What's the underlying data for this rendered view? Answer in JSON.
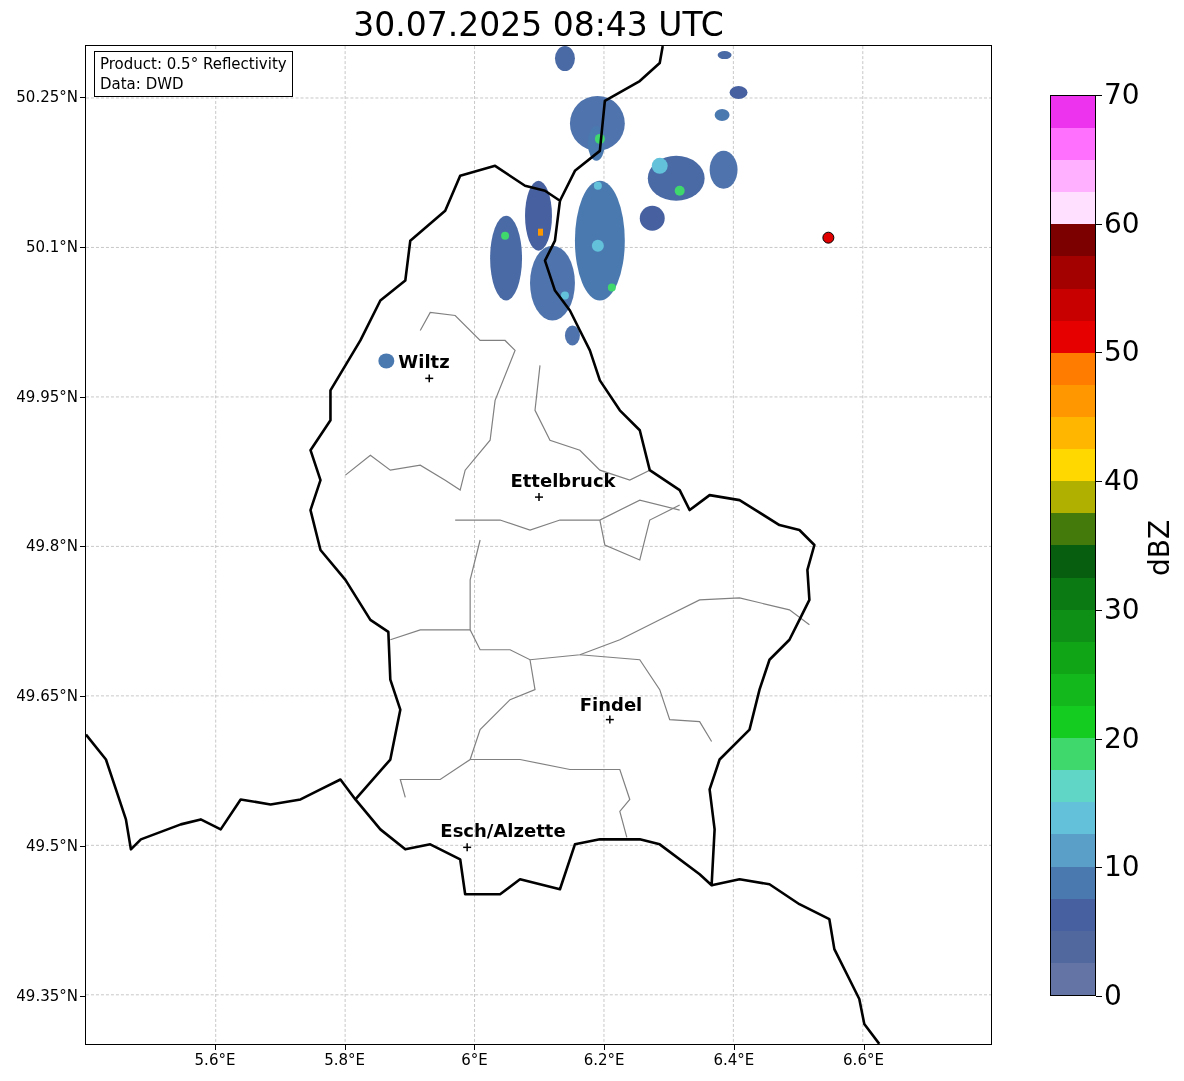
{
  "title": "30.07.2025 08:43 UTC",
  "info_box": {
    "lines": [
      "Product: 0.5° Reflectivity",
      "Data: DWD"
    ]
  },
  "map": {
    "cities": [
      {
        "name": "Wiltz"
      },
      {
        "name": "Ettelbruck"
      },
      {
        "name": "Findel"
      },
      {
        "name": "Esch/Alzette"
      }
    ],
    "x_ticks": [
      "5.6°E",
      "5.8°E",
      "6°E",
      "6.2°E",
      "6.4°E",
      "6.6°E"
    ],
    "y_ticks": [
      "50.25°N",
      "50.1°N",
      "49.95°N",
      "49.8°N",
      "49.65°N",
      "49.5°N",
      "49.35°N"
    ]
  },
  "colorbar": {
    "label": "dBZ",
    "ticks": [
      "70",
      "60",
      "50",
      "40",
      "30",
      "20",
      "10",
      "0"
    ],
    "segments": [
      {
        "color": "#6474a5"
      },
      {
        "color": "#51689f"
      },
      {
        "color": "#4660a0"
      },
      {
        "color": "#4a79b0"
      },
      {
        "color": "#5a9fc8"
      },
      {
        "color": "#63c2da"
      },
      {
        "color": "#60d6c6"
      },
      {
        "color": "#3fd86c"
      },
      {
        "color": "#14cc20"
      },
      {
        "color": "#12b81c"
      },
      {
        "color": "#10a516"
      },
      {
        "color": "#0d9015"
      },
      {
        "color": "#0c7a13"
      },
      {
        "color": "#075e0e"
      },
      {
        "color": "#447a0b"
      },
      {
        "color": "#b0b000"
      },
      {
        "color": "#ffd800"
      },
      {
        "color": "#ffb600"
      },
      {
        "color": "#ff9800"
      },
      {
        "color": "#ff7c00"
      },
      {
        "color": "#e60000"
      },
      {
        "color": "#c80000"
      },
      {
        "color": "#a30000"
      },
      {
        "color": "#7d0000"
      },
      {
        "color": "#ffe0ff"
      },
      {
        "color": "#ffb0ff"
      },
      {
        "color": "#ff70ff"
      },
      {
        "color": "#ee33ee"
      }
    ]
  }
}
